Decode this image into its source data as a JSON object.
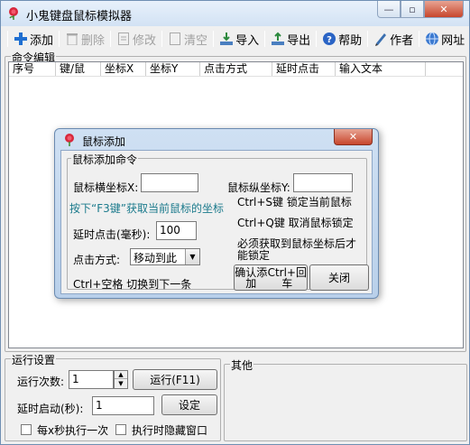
{
  "window": {
    "title": "小鬼键盘鼠标模拟器",
    "minimize": "—",
    "maximize": "▫",
    "close": "✕"
  },
  "toolbar": {
    "add": "添加",
    "delete": "删除",
    "edit": "修改",
    "clear": "清空",
    "import": "导入",
    "export": "导出",
    "help": "帮助",
    "author": "作者",
    "website": "网址"
  },
  "command_group": {
    "label": "命令编辑",
    "columns": [
      "序号",
      "键/鼠",
      "坐标X",
      "坐标Y",
      "点击方式",
      "延时点击",
      "输入文本"
    ]
  },
  "run_settings": {
    "label": "运行设置",
    "run_count_label": "运行次数:",
    "run_count_value": "1",
    "run_button": "运行(F11)",
    "delay_start_label": "延时启动(秒):",
    "delay_start_value": "1",
    "set_button": "设定",
    "every_x_sec_label": "每x秒执行一次",
    "hide_on_run_label": "执行时隐藏窗口"
  },
  "other_group": {
    "label": "其他"
  },
  "dialog": {
    "title": "鼠标添加",
    "close": "✕",
    "group_label": "鼠标添加命令",
    "x_label": "鼠标横坐标X:",
    "x_value": "",
    "y_label": "鼠标纵坐标Y:",
    "y_value": "",
    "hint_f3": "按下“F3键”获取当前鼠标的坐标",
    "hint_lock": "Ctrl+S键 锁定当前鼠标",
    "hint_unlock": "Ctrl+Q键 取消鼠标锁定",
    "hint_must_line1": "必须获取到鼠标坐标后才",
    "hint_must_line2": "能锁定",
    "delay_label": "延时点击(毫秒):",
    "delay_value": "100",
    "click_mode_label": "点击方式:",
    "click_mode_value": "移动到此",
    "confirm_line1": "确认添加",
    "confirm_line2": "Ctrl+回车",
    "close_button": "关闭",
    "next_hint": "Ctrl+空格 切换到下一条"
  }
}
